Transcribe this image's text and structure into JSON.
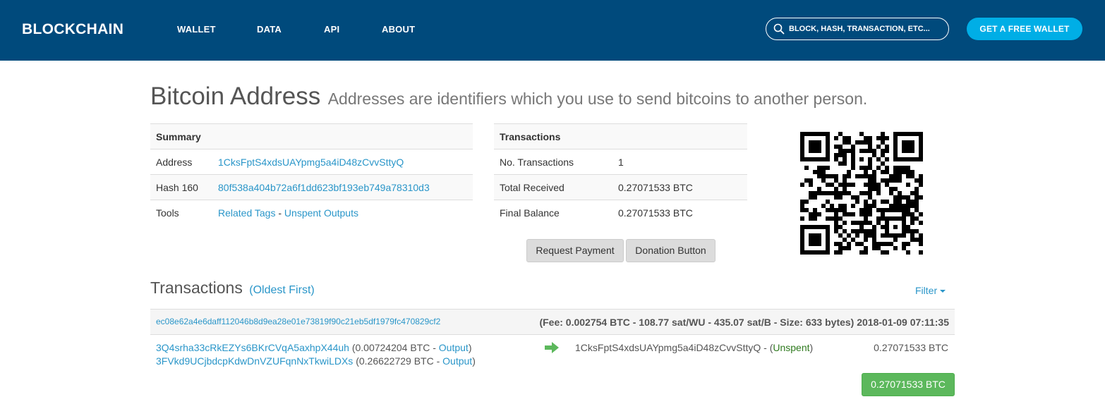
{
  "header": {
    "logo": "BLOCKCHAIN",
    "nav": [
      "WALLET",
      "DATA",
      "API",
      "ABOUT"
    ],
    "search_placeholder": "BLOCK, HASH, TRANSACTION, ETC...",
    "cta_label": "GET A FREE WALLET",
    "colors": {
      "navbar": "#004a7c",
      "cta": "#00aee6"
    }
  },
  "page": {
    "title": "Bitcoin Address",
    "subtitle": "Addresses are identifiers which you use to send bitcoins to another person."
  },
  "summary": {
    "heading": "Summary",
    "address_label": "Address",
    "address_value": "1CksFptS4xdsUAYpmg5a4iD48zCvvSttyQ",
    "hash160_label": "Hash 160",
    "hash160_value": "80f538a404b72a6f1dd623bf193eb749a78310d3",
    "tools_label": "Tools",
    "tools_related_tags": "Related Tags",
    "tools_separator": " - ",
    "tools_unspent_outputs": "Unspent Outputs"
  },
  "transactions_box": {
    "heading": "Transactions",
    "count_label": "No. Transactions",
    "count_value": "1",
    "received_label": "Total Received",
    "received_value": "0.27071533 BTC",
    "balance_label": "Final Balance",
    "balance_value": "0.27071533 BTC"
  },
  "buttons": {
    "request_payment": "Request Payment",
    "donation_button": "Donation Button"
  },
  "qr": {
    "icon": "qr-code"
  },
  "tx_section": {
    "title": "Transactions",
    "order_label": "(Oldest First)",
    "filter_label": "Filter"
  },
  "tx": {
    "hash": "ec08e62a4e6daff112046b8d9ea28e01e73819f90c21eb5df1979fc470829cf2",
    "meta": "(Fee: 0.002754 BTC - 108.77 sat/WU - 435.07 sat/B - Size: 633 bytes) 2018-01-09 07:11:35",
    "inputs": [
      {
        "address": "3Q4srha33cRkEZYs6BKrCVqA5axhpX44uh",
        "amount": " (0.00724204 BTC - ",
        "link": "Output",
        "close": ")"
      },
      {
        "address": "3FVkd9UCjbdcpKdwDnVZUFqnNxTkwiLDXs",
        "amount": " (0.26622729 BTC - ",
        "link": "Output",
        "close": ")"
      }
    ],
    "output_address": "1CksFptS4xdsUAYpmg5a4iD48zCvvSttyQ",
    "output_sep": " - (",
    "output_status": "Unspent",
    "output_close": ")",
    "output_amount": "0.27071533 BTC",
    "total": "0.27071533 BTC",
    "colors": {
      "total_badge": "#5cb85c",
      "unspent": "#2f7a1f",
      "arrow": "#5cb85c"
    }
  }
}
